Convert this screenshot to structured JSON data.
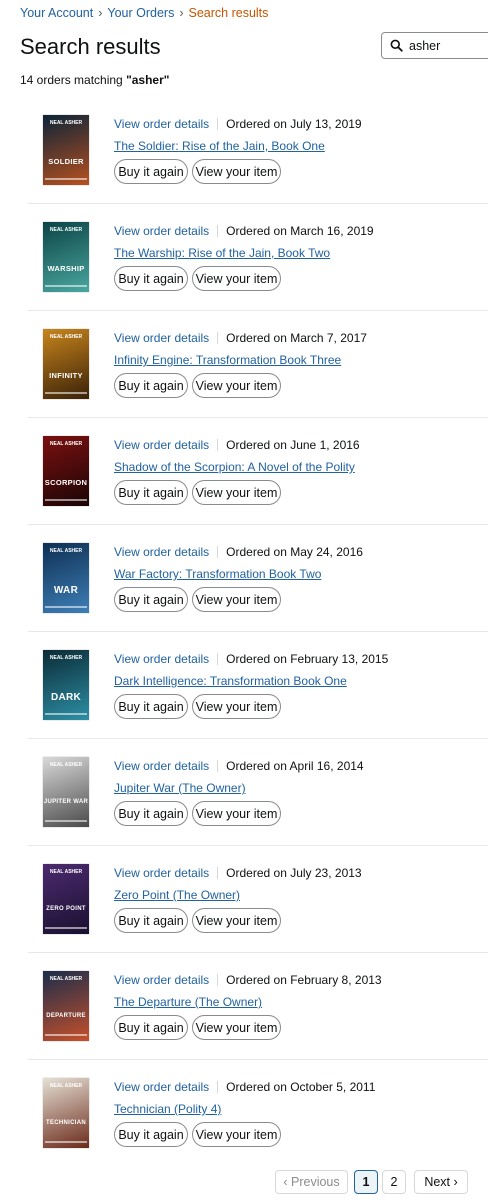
{
  "breadcrumb": {
    "account": "Your Account",
    "orders": "Your Orders",
    "current": "Search results",
    "separator": "›"
  },
  "page_title": "Search results",
  "search": {
    "value": "asher"
  },
  "match_count": {
    "prefix": "14 orders matching ",
    "query": "\"asher\""
  },
  "labels": {
    "view_order_details": "View order details",
    "buy_again": "Buy it again",
    "view_item": "View your item"
  },
  "orders": [
    {
      "date": "Ordered on July 13, 2019",
      "title": "The Soldier: Rise of the Jain, Book One",
      "cover": {
        "author": "NEAL ASHER",
        "title": "SOLDIER",
        "colors": [
          "#0b2438",
          "#b8501f"
        ]
      }
    },
    {
      "date": "Ordered on March 16, 2019",
      "title": "The Warship: Rise of the Jain, Book Two",
      "cover": {
        "author": "NEAL ASHER",
        "title": "WARSHIP",
        "colors": [
          "#0c4446",
          "#4aa7a0"
        ]
      }
    },
    {
      "date": "Ordered on March 7, 2017",
      "title": "Infinity Engine: Transformation Book Three",
      "cover": {
        "author": "NEAL ASHER",
        "title": "INFINITY",
        "colors": [
          "#c7851c",
          "#3a2108"
        ]
      }
    },
    {
      "date": "Ordered on June 1, 2016",
      "title": "Shadow of the Scorpion: A Novel of the Polity",
      "cover": {
        "author": "NEAL ASHER",
        "title": "SCORPION",
        "colors": [
          "#7a1010",
          "#1b0505"
        ]
      }
    },
    {
      "date": "Ordered on May 24, 2016",
      "title": "War Factory: Transformation Book Two",
      "cover": {
        "author": "NEAL ASHER",
        "title": "WAR",
        "colors": [
          "#0e2f52",
          "#3e7fb8"
        ]
      }
    },
    {
      "date": "Ordered on February 13, 2015",
      "title": "Dark Intelligence: Transformation Book One",
      "cover": {
        "author": "NEAL ASHER",
        "title": "DARK",
        "colors": [
          "#0b2b36",
          "#2d8fa5"
        ]
      }
    },
    {
      "date": "Ordered on April 16, 2014",
      "title": "Jupiter War (The Owner)",
      "cover": {
        "author": "NEAL ASHER",
        "title": "JUPITER WAR",
        "colors": [
          "#d9d9d9",
          "#4a4a4a"
        ]
      }
    },
    {
      "date": "Ordered on July 23, 2013",
      "title": "Zero Point (The Owner)",
      "cover": {
        "author": "NEAL ASHER",
        "title": "ZERO POINT",
        "colors": [
          "#4b2a6e",
          "#1a1030"
        ]
      }
    },
    {
      "date": "Ordered on February 8, 2013",
      "title": "The Departure (The Owner)",
      "cover": {
        "author": "NEAL ASHER",
        "title": "DEPARTURE",
        "colors": [
          "#1b2d4c",
          "#c6502a"
        ]
      }
    },
    {
      "date": "Ordered on October 5, 2011",
      "title": "Technician (Polity 4)",
      "cover": {
        "author": "NEAL ASHER",
        "title": "TECHNICIAN",
        "colors": [
          "#e6e1d6",
          "#6b2a1a"
        ]
      }
    }
  ],
  "pagination": {
    "previous": "Previous",
    "pages": [
      "1",
      "2"
    ],
    "current": "1",
    "next": "Next"
  }
}
